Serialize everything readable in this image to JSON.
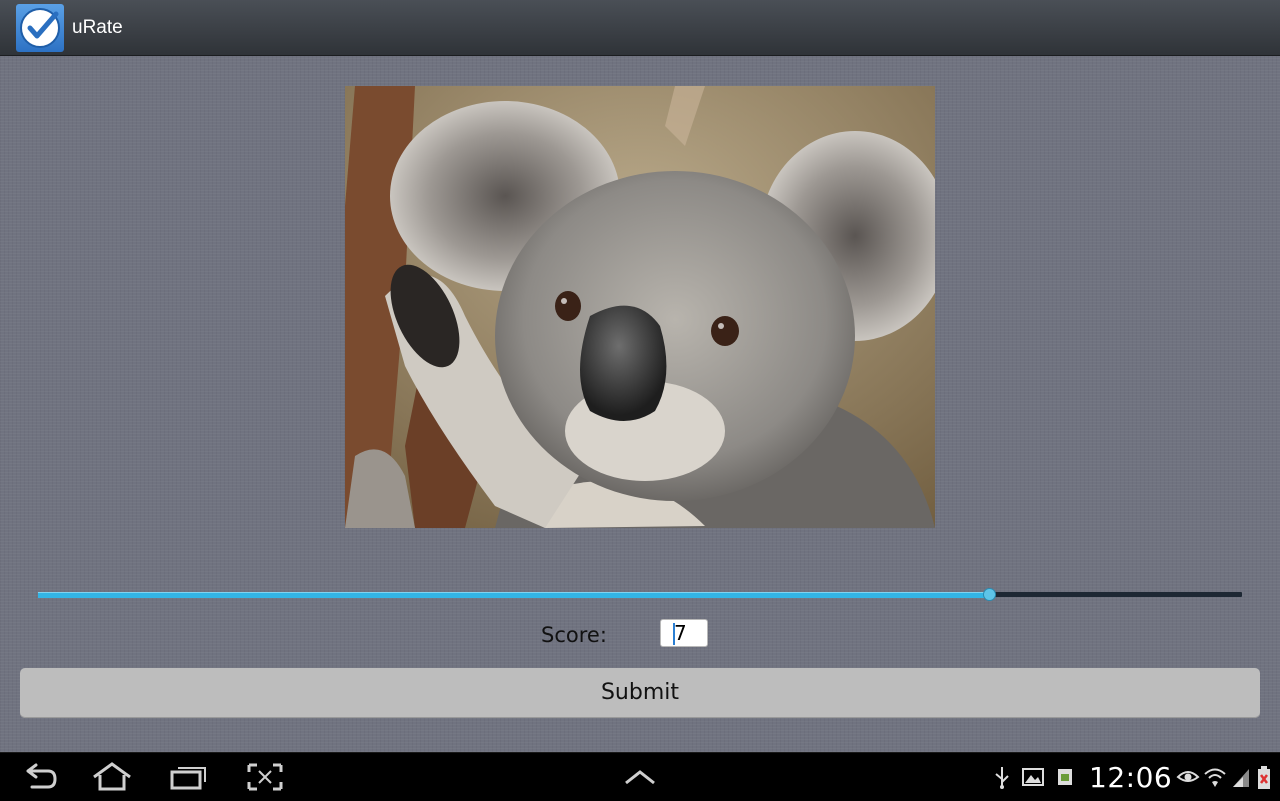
{
  "app": {
    "title": "uRate",
    "icon": "checkmark-app-icon",
    "accent": "#33b5e5"
  },
  "main": {
    "image": {
      "subject": "koala-photo"
    },
    "slider": {
      "value": 7,
      "max": 9,
      "fraction": 0.79
    },
    "score_label": "Score:",
    "score_value": "7",
    "submit_label": "Submit"
  },
  "system_bar": {
    "time": "12:06",
    "nav_icons": [
      "back-icon",
      "home-icon",
      "recent-apps-icon",
      "screenshot-icon",
      "up-chevron-icon"
    ],
    "status_icons": [
      "usb-icon",
      "gallery-icon",
      "sim-icon",
      "eye-icon",
      "wifi-icon",
      "signal-icon",
      "battery-icon"
    ]
  }
}
